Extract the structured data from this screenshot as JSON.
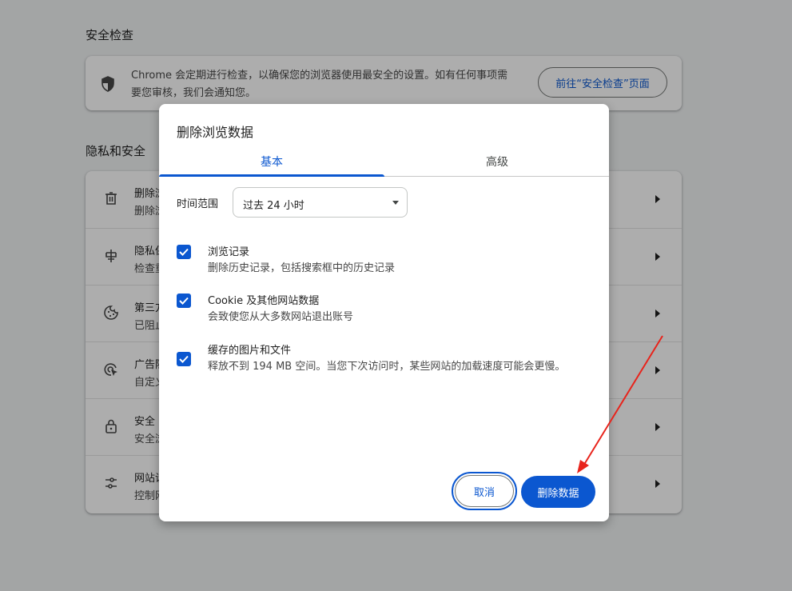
{
  "safety_check": {
    "title": "安全检查",
    "description": "Chrome 会定期进行检查，以确保您的浏览器使用最安全的设置。如有任何事项需要您审核，我们会通知您。",
    "button_label": "前往“安全检查”页面"
  },
  "privacy": {
    "title": "隐私和安全",
    "rows": [
      {
        "icon": "trash-icon",
        "title": "删除浏",
        "subtitle": "删除浏"
      },
      {
        "icon": "privacy-guide-icon",
        "title": "隐私保",
        "subtitle": "检查重"
      },
      {
        "icon": "cookie-icon",
        "title": "第三方",
        "subtitle": "已阻止"
      },
      {
        "icon": "ad-privacy-icon",
        "title": "广告隐",
        "subtitle": "自定义"
      },
      {
        "icon": "lock-icon",
        "title": "安全",
        "subtitle": "安全浏"
      },
      {
        "icon": "site-settings-icon",
        "title": "网站设",
        "subtitle": "控制网"
      }
    ]
  },
  "dialog": {
    "title": "删除浏览数据",
    "tabs": [
      {
        "label": "基本",
        "active": true
      },
      {
        "label": "高级",
        "active": false
      }
    ],
    "time_range": {
      "label": "时间范围",
      "value": "过去 24 小时"
    },
    "options": [
      {
        "title": "浏览记录",
        "subtitle": "删除历史记录，包括搜索框中的历史记录",
        "checked": true
      },
      {
        "title": "Cookie 及其他网站数据",
        "subtitle": "会致使您从大多数网站退出账号",
        "checked": true
      },
      {
        "title": "缓存的图片和文件",
        "subtitle": "释放不到 194 MB 空间。当您下次访问时，某些网站的加载速度可能会更慢。",
        "checked": true
      }
    ],
    "cancel_label": "取消",
    "delete_label": "删除数据"
  },
  "colors": {
    "accent": "#0b57d0",
    "annotation_arrow": "#e8231b"
  }
}
